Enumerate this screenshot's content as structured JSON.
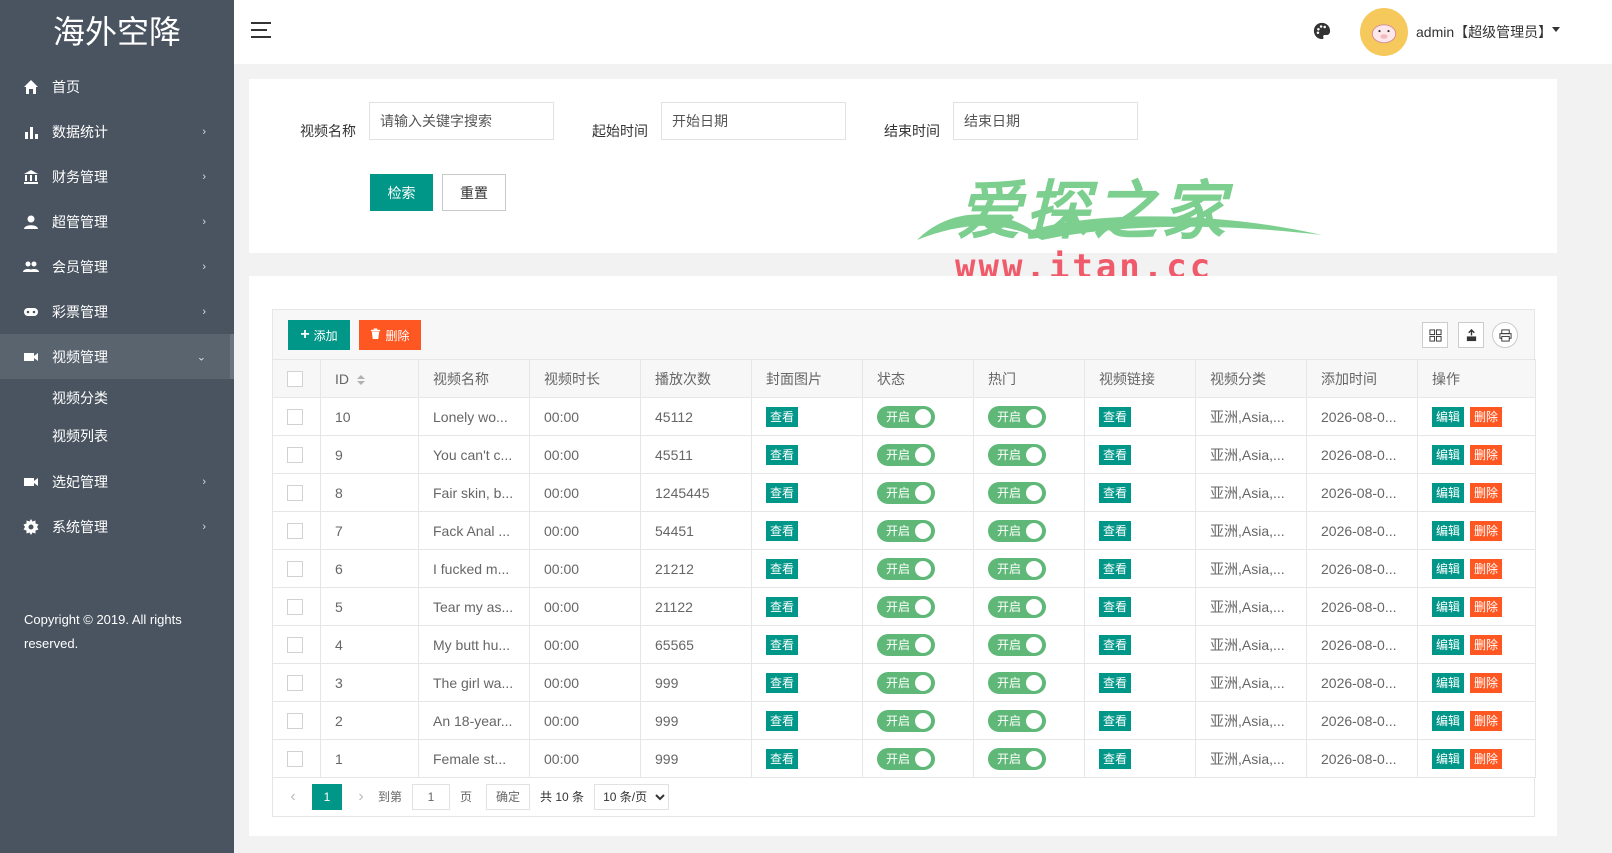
{
  "brand": "海外空降",
  "sidebar": {
    "items": [
      {
        "label": "首页",
        "icon": "home-icon",
        "has_children": false
      },
      {
        "label": "数据统计",
        "icon": "bar-chart-icon",
        "has_children": true
      },
      {
        "label": "财务管理",
        "icon": "bank-icon",
        "has_children": true
      },
      {
        "label": "超管管理",
        "icon": "user-icon",
        "has_children": true
      },
      {
        "label": "会员管理",
        "icon": "group-icon",
        "has_children": true
      },
      {
        "label": "彩票管理",
        "icon": "gamepad-icon",
        "has_children": true
      },
      {
        "label": "视频管理",
        "icon": "video-icon",
        "has_children": true,
        "expanded": true
      },
      {
        "label": "选妃管理",
        "icon": "video-icon",
        "has_children": true
      },
      {
        "label": "系统管理",
        "icon": "gear-icon",
        "has_children": true
      }
    ],
    "submenu": [
      "视频分类",
      "视频列表"
    ],
    "copyright": "Copyright © 2019. All rights reserved."
  },
  "header": {
    "user": "admin【超级管理员】"
  },
  "search": {
    "name_label": "视频名称",
    "name_placeholder": "请输入关键字搜索",
    "start_label": "起始时间",
    "start_placeholder": "开始日期",
    "end_label": "结束时间",
    "end_placeholder": "结束日期",
    "search_btn": "检索",
    "reset_btn": "重置"
  },
  "watermark": {
    "cn": "爱探之家",
    "url": "www.itan.cc"
  },
  "toolbar": {
    "add": "添加",
    "delete": "删除"
  },
  "table": {
    "columns": [
      "ID",
      "视频名称",
      "视频时长",
      "播放次数",
      "封面图片",
      "状态",
      "热门",
      "视频链接",
      "视频分类",
      "添加时间",
      "操作"
    ],
    "view_label": "查看",
    "switch_label": "开启",
    "edit_label": "编辑",
    "remove_label": "删除",
    "rows": [
      {
        "id": "10",
        "name": "Lonely wo...",
        "duration": "00:00",
        "plays": "45112",
        "category": "亚洲,Asia,...",
        "added": "2026-08-0..."
      },
      {
        "id": "9",
        "name": "You can't c...",
        "duration": "00:00",
        "plays": "45511",
        "category": "亚洲,Asia,...",
        "added": "2026-08-0..."
      },
      {
        "id": "8",
        "name": "Fair skin, b...",
        "duration": "00:00",
        "plays": "1245445",
        "category": "亚洲,Asia,...",
        "added": "2026-08-0..."
      },
      {
        "id": "7",
        "name": "Fack Anal ...",
        "duration": "00:00",
        "plays": "54451",
        "category": "亚洲,Asia,...",
        "added": "2026-08-0..."
      },
      {
        "id": "6",
        "name": "I fucked m...",
        "duration": "00:00",
        "plays": "21212",
        "category": "亚洲,Asia,...",
        "added": "2026-08-0..."
      },
      {
        "id": "5",
        "name": "Tear my as...",
        "duration": "00:00",
        "plays": "21122",
        "category": "亚洲,Asia,...",
        "added": "2026-08-0..."
      },
      {
        "id": "4",
        "name": "My butt hu...",
        "duration": "00:00",
        "plays": "65565",
        "category": "亚洲,Asia,...",
        "added": "2026-08-0..."
      },
      {
        "id": "3",
        "name": "The girl wa...",
        "duration": "00:00",
        "plays": "999",
        "category": "亚洲,Asia,...",
        "added": "2026-08-0..."
      },
      {
        "id": "2",
        "name": "An 18-year...",
        "duration": "00:00",
        "plays": "999",
        "category": "亚洲,Asia,...",
        "added": "2026-08-0..."
      },
      {
        "id": "1",
        "name": "Female st...",
        "duration": "00:00",
        "plays": "999",
        "category": "亚洲,Asia,...",
        "added": "2026-08-0..."
      }
    ]
  },
  "pager": {
    "current": "1",
    "goto_label": "到第",
    "page_input": "1",
    "page_unit": "页",
    "confirm": "确定",
    "total": "共 10 条",
    "page_size": "10 条/页"
  },
  "colors": {
    "sidebar_bg": "#4a5460",
    "primary": "#009688",
    "danger": "#ff5722",
    "switch_on": "#5fb878"
  }
}
